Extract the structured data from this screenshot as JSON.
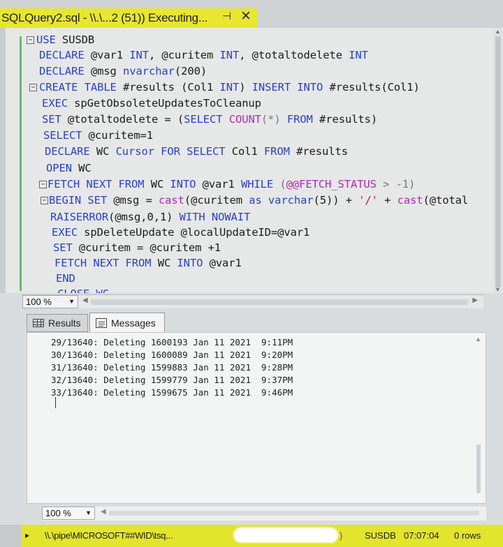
{
  "tab": {
    "title": "SQLQuery2.sql - \\\\.\\...2 (51)) Executing...",
    "pin_glyph": "⊣",
    "close_glyph": "✕"
  },
  "editor": {
    "lines": [
      [
        {
          "t": "USE",
          "c": "kw"
        },
        {
          "t": " SUSDB",
          "c": ""
        }
      ],
      [
        {
          "t": "DECLARE",
          "c": "kw"
        },
        {
          "t": " @var1 ",
          "c": ""
        },
        {
          "t": "INT",
          "c": "kw"
        },
        {
          "t": ", @curitem ",
          "c": ""
        },
        {
          "t": "INT",
          "c": "kw"
        },
        {
          "t": ", @totaltodelete ",
          "c": ""
        },
        {
          "t": "INT",
          "c": "kw"
        }
      ],
      [
        {
          "t": "DECLARE",
          "c": "kw"
        },
        {
          "t": " @msg ",
          "c": ""
        },
        {
          "t": "nvarchar",
          "c": "kw"
        },
        {
          "t": "(200)",
          "c": ""
        }
      ],
      [
        {
          "t": "CREATE TABLE",
          "c": "kw"
        },
        {
          "t": " #results (Col1 ",
          "c": ""
        },
        {
          "t": "INT",
          "c": "kw"
        },
        {
          "t": ") ",
          "c": ""
        },
        {
          "t": "INSERT INTO",
          "c": "kw"
        },
        {
          "t": " #results(Col1)",
          "c": ""
        }
      ],
      [
        {
          "t": "EXEC",
          "c": "kw"
        },
        {
          "t": " spGetObsoleteUpdatesToCleanup",
          "c": ""
        }
      ],
      [
        {
          "t": "SET",
          "c": "kw"
        },
        {
          "t": " @totaltodelete = (",
          "c": ""
        },
        {
          "t": "SELECT",
          "c": "kw"
        },
        {
          "t": " ",
          "c": ""
        },
        {
          "t": "COUNT",
          "c": "fn"
        },
        {
          "t": "(*) ",
          "c": "gy"
        },
        {
          "t": "FROM",
          "c": "kw"
        },
        {
          "t": " #results)",
          "c": ""
        }
      ],
      [
        {
          "t": "SELECT",
          "c": "kw"
        },
        {
          "t": " @curitem=1",
          "c": ""
        }
      ],
      [
        {
          "t": "DECLARE",
          "c": "kw"
        },
        {
          "t": " WC ",
          "c": ""
        },
        {
          "t": "Cursor FOR SELECT",
          "c": "kw"
        },
        {
          "t": " Col1 ",
          "c": ""
        },
        {
          "t": "FROM",
          "c": "kw"
        },
        {
          "t": " #results",
          "c": ""
        }
      ],
      [
        {
          "t": "OPEN",
          "c": "kw"
        },
        {
          "t": " WC",
          "c": ""
        }
      ],
      [
        {
          "t": "FETCH NEXT FROM",
          "c": "kw"
        },
        {
          "t": " WC ",
          "c": ""
        },
        {
          "t": "INTO",
          "c": "kw"
        },
        {
          "t": " @var1 ",
          "c": ""
        },
        {
          "t": "WHILE",
          "c": "kw"
        },
        {
          "t": " (",
          "c": "gy"
        },
        {
          "t": "@@FETCH_STATUS",
          "c": "fn"
        },
        {
          "t": " > -1)",
          "c": "gy"
        }
      ],
      [
        {
          "t": "BEGIN SET",
          "c": "kw"
        },
        {
          "t": " @msg = ",
          "c": ""
        },
        {
          "t": "cast",
          "c": "fn"
        },
        {
          "t": "(@curitem ",
          "c": ""
        },
        {
          "t": "as varchar",
          "c": "kw"
        },
        {
          "t": "(5)) + ",
          "c": ""
        },
        {
          "t": "'/'",
          "c": "st"
        },
        {
          "t": " + ",
          "c": ""
        },
        {
          "t": "cast",
          "c": "fn"
        },
        {
          "t": "(@total",
          "c": ""
        }
      ],
      [
        {
          "t": "RAISERROR",
          "c": "kw"
        },
        {
          "t": "(@msg,0,1) ",
          "c": ""
        },
        {
          "t": "WITH NOWAIT",
          "c": "kw"
        }
      ],
      [
        {
          "t": "EXEC",
          "c": "kw"
        },
        {
          "t": " spDeleteUpdate @localUpdateID=@var1",
          "c": ""
        }
      ],
      [
        {
          "t": "SET",
          "c": "kw"
        },
        {
          "t": " @curitem = @curitem +1",
          "c": ""
        }
      ],
      [
        {
          "t": "FETCH NEXT FROM",
          "c": "kw"
        },
        {
          "t": " WC ",
          "c": ""
        },
        {
          "t": "INTO",
          "c": "kw"
        },
        {
          "t": " @var1",
          "c": ""
        }
      ],
      [
        {
          "t": "END",
          "c": "kw"
        }
      ],
      [
        {
          "t": "CLOSE WC",
          "c": "kw"
        }
      ]
    ]
  },
  "editor_zoom": "100 %",
  "result_tabs": {
    "results_label": "Results",
    "messages_label": "Messages"
  },
  "messages": [
    "29/13640: Deleting 1600193 Jan 11 2021  9:11PM",
    "30/13640: Deleting 1600089 Jan 11 2021  9:20PM",
    "31/13640: Deleting 1599883 Jan 11 2021  9:28PM",
    "32/13640: Deleting 1599779 Jan 11 2021  9:37PM",
    "33/13640: Deleting 1599675 Jan 11 2021  9:46PM"
  ],
  "messages_zoom": "100 %",
  "status": {
    "connection": "\\\\.\\pipe\\MICROSOFT##WID\\tsq...",
    "paren": ")",
    "database": "SUSDB",
    "elapsed": "07:07:04",
    "rows": "0 rows"
  }
}
